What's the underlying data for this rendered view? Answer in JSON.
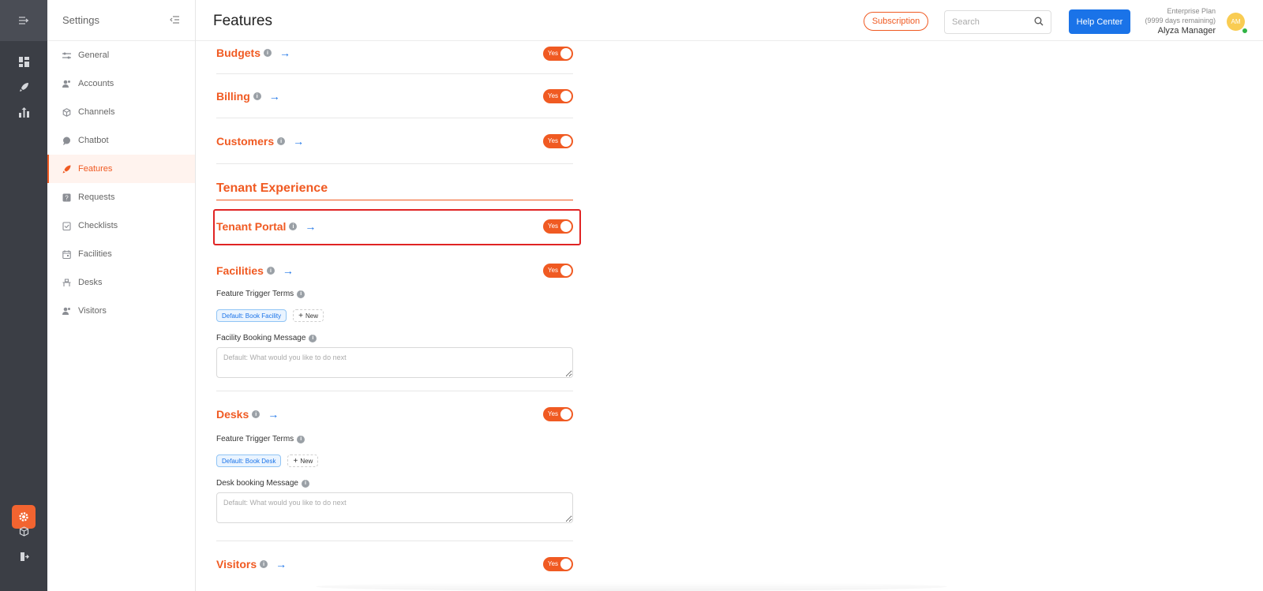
{
  "rail": {
    "icons": [
      "menu-expand-icon",
      "dashboard-icon",
      "features-rocket-icon",
      "reports-icon",
      "settings-gear-icon",
      "box-icon",
      "logout-icon"
    ]
  },
  "sidebar": {
    "title": "Settings",
    "items": [
      {
        "label": "General",
        "icon": "sliders-icon"
      },
      {
        "label": "Accounts",
        "icon": "users-icon"
      },
      {
        "label": "Channels",
        "icon": "cube-icon"
      },
      {
        "label": "Chatbot",
        "icon": "chat-icon"
      },
      {
        "label": "Features",
        "icon": "rocket-icon",
        "active": true
      },
      {
        "label": "Requests",
        "icon": "question-icon"
      },
      {
        "label": "Checklists",
        "icon": "checklist-icon"
      },
      {
        "label": "Facilities",
        "icon": "calendar-icon"
      },
      {
        "label": "Desks",
        "icon": "desk-icon"
      },
      {
        "label": "Visitors",
        "icon": "visitors-icon"
      }
    ]
  },
  "header": {
    "title": "Features",
    "subscription_label": "Subscription",
    "search_placeholder": "Search",
    "help_label": "Help Center",
    "plan": "Enterprise Plan",
    "days_remaining": "(9999 days remaining)",
    "user_name": "Alyza Manager",
    "avatar_initials": "AM"
  },
  "features": {
    "toggle_label": "Yes",
    "budgets": "Budgets",
    "billing": "Billing",
    "customers": "Customers",
    "section_title": "Tenant Experience",
    "tenant_portal": "Tenant Portal",
    "facilities": {
      "name": "Facilities",
      "trigger_label": "Feature Trigger Terms",
      "chip": "Default: Book Facility",
      "new_label": "New",
      "message_label": "Facility Booking Message",
      "message_placeholder": "Default: What would you like to do next"
    },
    "desks": {
      "name": "Desks",
      "trigger_label": "Feature Trigger Terms",
      "chip": "Default: Book Desk",
      "new_label": "New",
      "message_label": "Desk booking Message",
      "message_placeholder": "Default: What would you like to do next"
    },
    "visitors": "Visitors"
  },
  "colors": {
    "accent": "#f05a22",
    "primary": "#1a73e8",
    "rail": "#3b3e45",
    "highlight": "#e02424"
  }
}
